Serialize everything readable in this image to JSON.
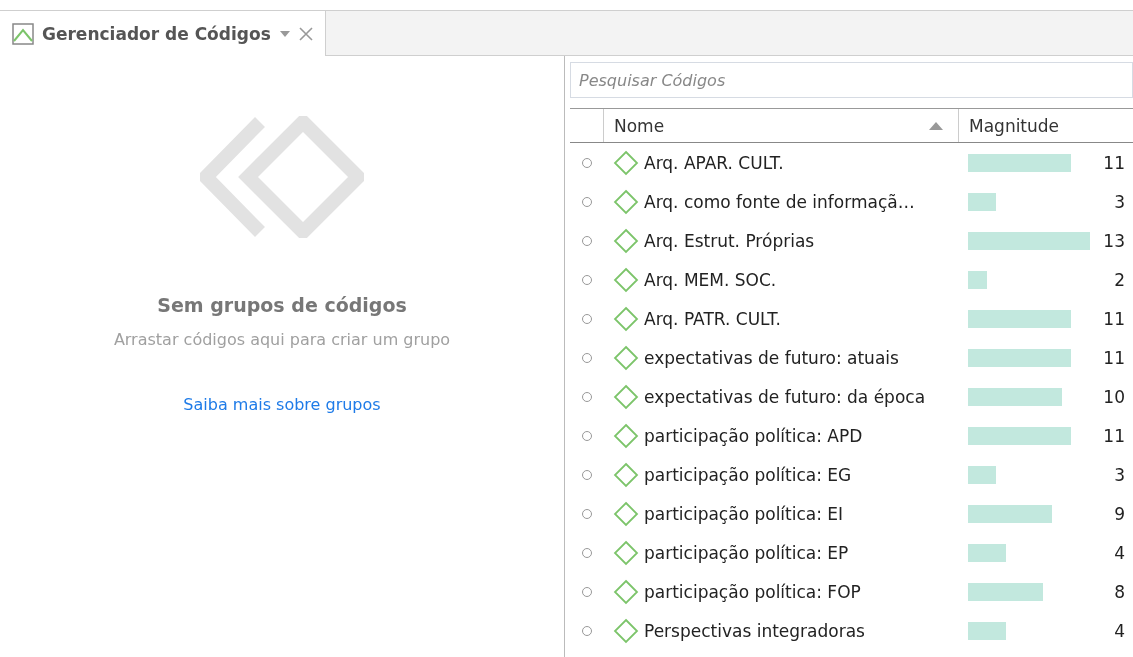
{
  "tab": {
    "title": "Gerenciador de Códigos",
    "selected": true
  },
  "groups_panel": {
    "heading": "Sem grupos de códigos",
    "hint": "Arrastar códigos aqui para criar um grupo",
    "link": "Saiba mais sobre grupos"
  },
  "search": {
    "placeholder": "Pesquisar Códigos"
  },
  "table": {
    "columns": [
      {
        "label": "Nome",
        "sorted": true
      },
      {
        "label": "Magnitude"
      }
    ],
    "rows": [
      {
        "name": "Arq. APAR. CULT.",
        "magnitude": "11",
        "selected": false
      },
      {
        "name": "Arq. como fonte de informaçã…",
        "magnitude": "3",
        "selected": false
      },
      {
        "name": "Arq. Estrut. Próprias",
        "magnitude": "13",
        "selected": false
      },
      {
        "name": "Arq. MEM. SOC.",
        "magnitude": "2",
        "selected": false
      },
      {
        "name": "Arq. PATR. CULT.",
        "magnitude": "11",
        "selected": false
      },
      {
        "name": "expectativas de futuro: atuais",
        "magnitude": "11",
        "selected": false
      },
      {
        "name": "expectativas de futuro: da época",
        "magnitude": "10",
        "selected": false
      },
      {
        "name": "participação política: APD",
        "magnitude": "11",
        "selected": false
      },
      {
        "name": "participação política: EG",
        "magnitude": "3",
        "selected": false
      },
      {
        "name": "participação política: EI",
        "magnitude": "9",
        "selected": false
      },
      {
        "name": "participação política: EP",
        "magnitude": "4",
        "selected": false
      },
      {
        "name": "participação política: FOP",
        "magnitude": "8",
        "selected": false
      },
      {
        "name": "Perspectivas integradoras",
        "magnitude": "4",
        "selected": false
      }
    ]
  }
}
